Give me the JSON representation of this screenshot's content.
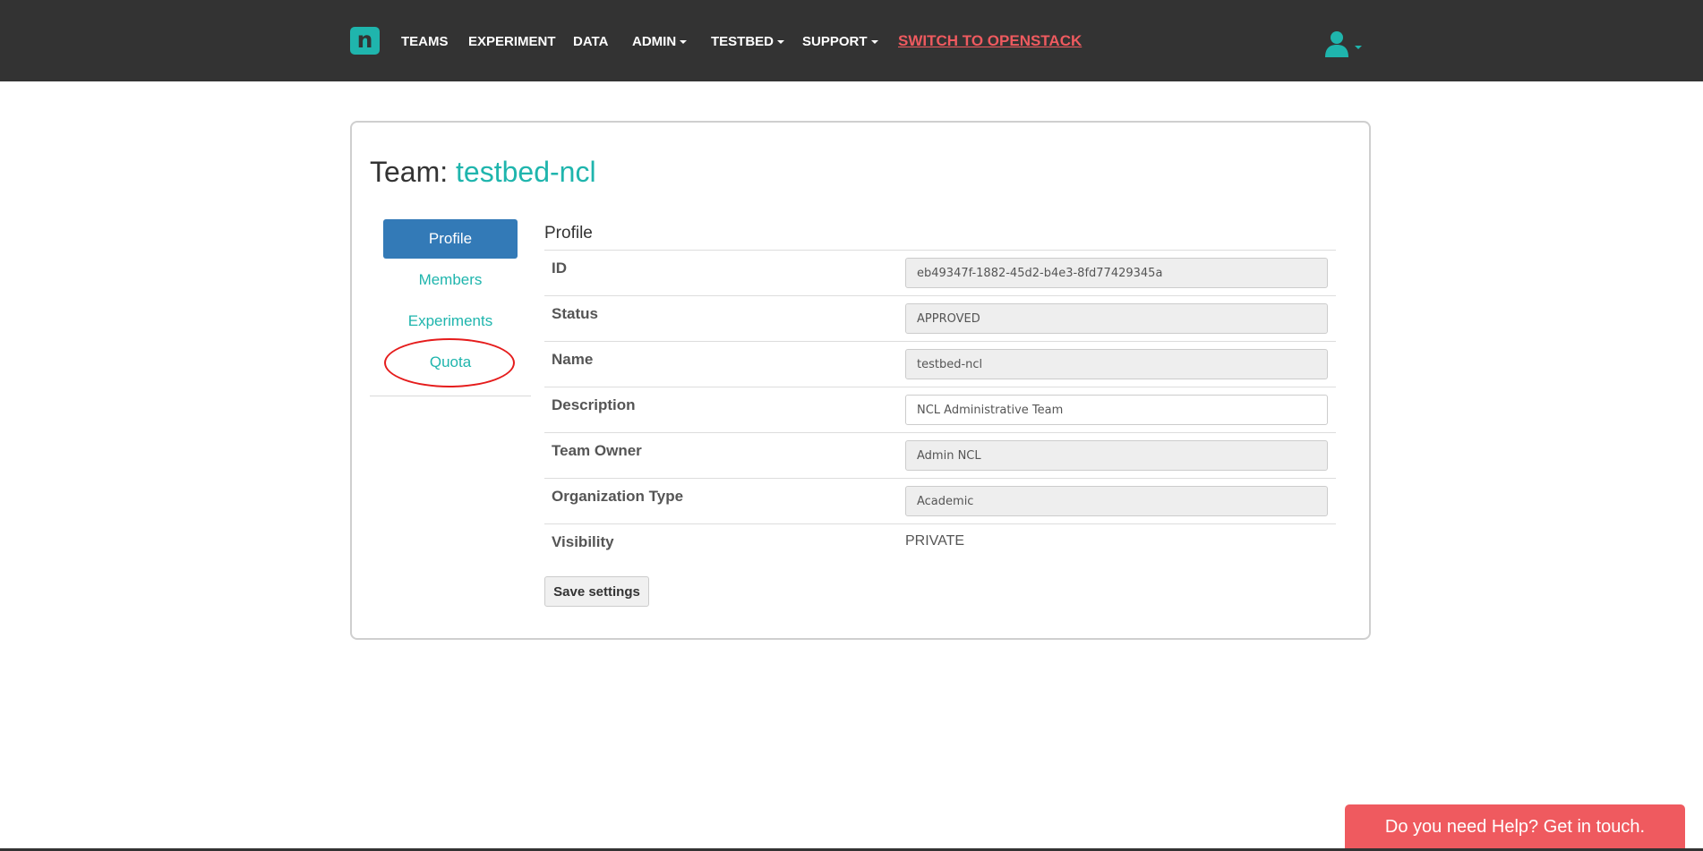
{
  "colors": {
    "navbar_bg": "#333333",
    "brand_teal": "#1fb5ad",
    "active_tab_blue": "#337ab7",
    "openstack_red": "#ef5a5f",
    "help_red": "#ef5a5f",
    "highlight_circle": "#e51c1c"
  },
  "nav": {
    "logo_letter": "n",
    "teams": "TEAMS",
    "experiment": "EXPERIMENT",
    "data": "DATA",
    "admin": "ADMIN",
    "testbed": "TESTBED",
    "support": "SUPPORT",
    "openstack": "SWITCH TO OPENSTACK",
    "user_icon": "user-icon"
  },
  "page": {
    "title_prefix": "Team:",
    "team_name": "testbed-ncl"
  },
  "tabs": {
    "items": [
      {
        "label": "Profile",
        "active": true
      },
      {
        "label": "Members",
        "active": false
      },
      {
        "label": "Experiments",
        "active": false
      },
      {
        "label": "Quota",
        "active": false,
        "highlighted": true
      }
    ]
  },
  "profile": {
    "section_title": "Profile",
    "fields": [
      {
        "label": "ID",
        "value": "eb49347f-1882-45d2-b4e3-8fd77429345a",
        "readonly": true
      },
      {
        "label": "Status",
        "value": "APPROVED",
        "readonly": true
      },
      {
        "label": "Name",
        "value": "testbed-ncl",
        "readonly": true
      },
      {
        "label": "Description",
        "value": "NCL Administrative Team",
        "readonly": false
      },
      {
        "label": "Team Owner",
        "value": "Admin NCL",
        "readonly": true
      },
      {
        "label": "Organization Type",
        "value": "Academic",
        "readonly": true
      },
      {
        "label": "Visibility",
        "value": "PRIVATE",
        "readonly": true
      }
    ],
    "save_label": "Save settings"
  },
  "help": {
    "label": "Do you need Help? Get in touch."
  }
}
